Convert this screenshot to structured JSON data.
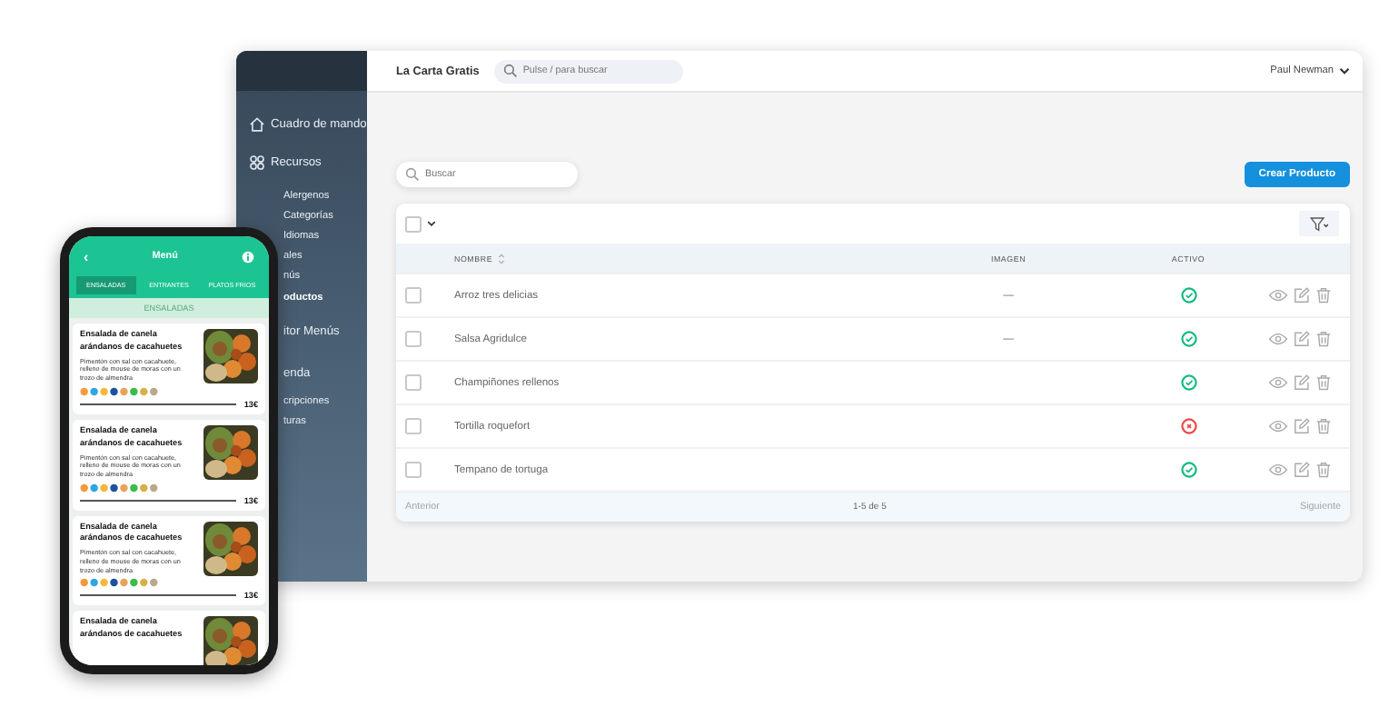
{
  "app": {
    "brand": "La Carta Gratis",
    "search_placeholder": "Pulse / para buscar",
    "user": "Paul Newman"
  },
  "sidebar": {
    "items": [
      {
        "label": "Cuadro de mando",
        "selected": false
      },
      {
        "label": "Recursos",
        "selected": false,
        "children": [
          {
            "label": "Alergenos",
            "selected": false
          },
          {
            "label": "Categorías",
            "selected": false
          },
          {
            "label": "Idiomas",
            "selected": false
          },
          {
            "label": "ales",
            "selected": false
          },
          {
            "label": "nús",
            "selected": false
          },
          {
            "label": "oductos",
            "selected": true
          }
        ]
      },
      {
        "label": "itor Menús",
        "selected": false
      },
      {
        "label": "enda",
        "selected": false,
        "children": [
          {
            "label": "cripciones",
            "selected": false
          },
          {
            "label": "turas",
            "selected": false
          }
        ]
      }
    ]
  },
  "toolbar": {
    "search_placeholder": "Buscar",
    "create_button": "Crear Producto"
  },
  "table": {
    "columns": [
      "NOMBRE",
      "IMAGEN",
      "ACTIVO"
    ],
    "rows": [
      {
        "checked": false,
        "name": "Arroz tres delicias",
        "image": "—",
        "active": true
      },
      {
        "checked": false,
        "name": "Salsa Agridulce",
        "image": "—",
        "active": true
      },
      {
        "checked": false,
        "name": "Champiñones rellenos",
        "active": true
      },
      {
        "checked": false,
        "name": "Tortilla roquefort",
        "active": false
      },
      {
        "checked": false,
        "name": "Tempano de tortuga",
        "active": true
      }
    ],
    "footer": {
      "previous": "Anterior",
      "range": "1-5 de 5",
      "next": "Siguiente"
    }
  },
  "phone": {
    "back": "‹",
    "title": "Menú",
    "tabs": [
      {
        "label": "ENSALADAS",
        "selected": true
      },
      {
        "label": "ENTRANTES",
        "selected": false
      },
      {
        "label": "PLATOS FRIOS",
        "selected": false
      }
    ],
    "section": "ENSALADAS",
    "dishes": [
      {
        "title": "Ensalada de canela arándanos de cacahuetes",
        "description": "Pimentón con sal con cacahuete, relleno de mouse de moras con un trozo de almendra",
        "price": "13€"
      },
      {
        "title": "Ensalada de canela arándanos de cacahuetes",
        "description": "Pimentón con sal con cacahuete, relleno de mouse de moras con un trozo de almendra",
        "price": "13€"
      },
      {
        "title": "Ensalada de canela arándanos de cacahuetes",
        "description": "Pimentón con sal con cacahuete, relleno de mouse de moras con un trozo de almendra",
        "price": "13€"
      },
      {
        "title": "Ensalada de canela arándanos de cacahuetes"
      }
    ]
  }
}
